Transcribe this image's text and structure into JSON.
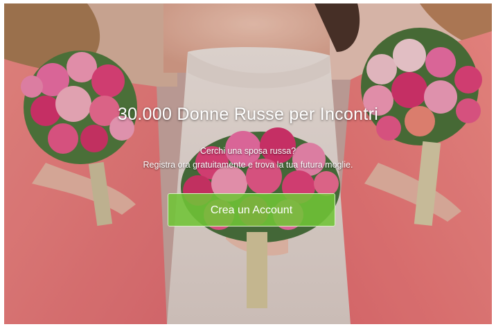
{
  "hero": {
    "headline": "30.000 Donne Russe per Incontri",
    "subtitle_line1": "Cerchi una sposa russa?",
    "subtitle_line2": "Registra ora gratuitamente e trova la tua futura moglie.",
    "cta_label": "Crea un Account"
  },
  "colors": {
    "dress_coral": "#f07f7c",
    "gown_ivory": "#ece3dc",
    "rose_pink": "#e2427a",
    "cta_green": "#70c437"
  }
}
